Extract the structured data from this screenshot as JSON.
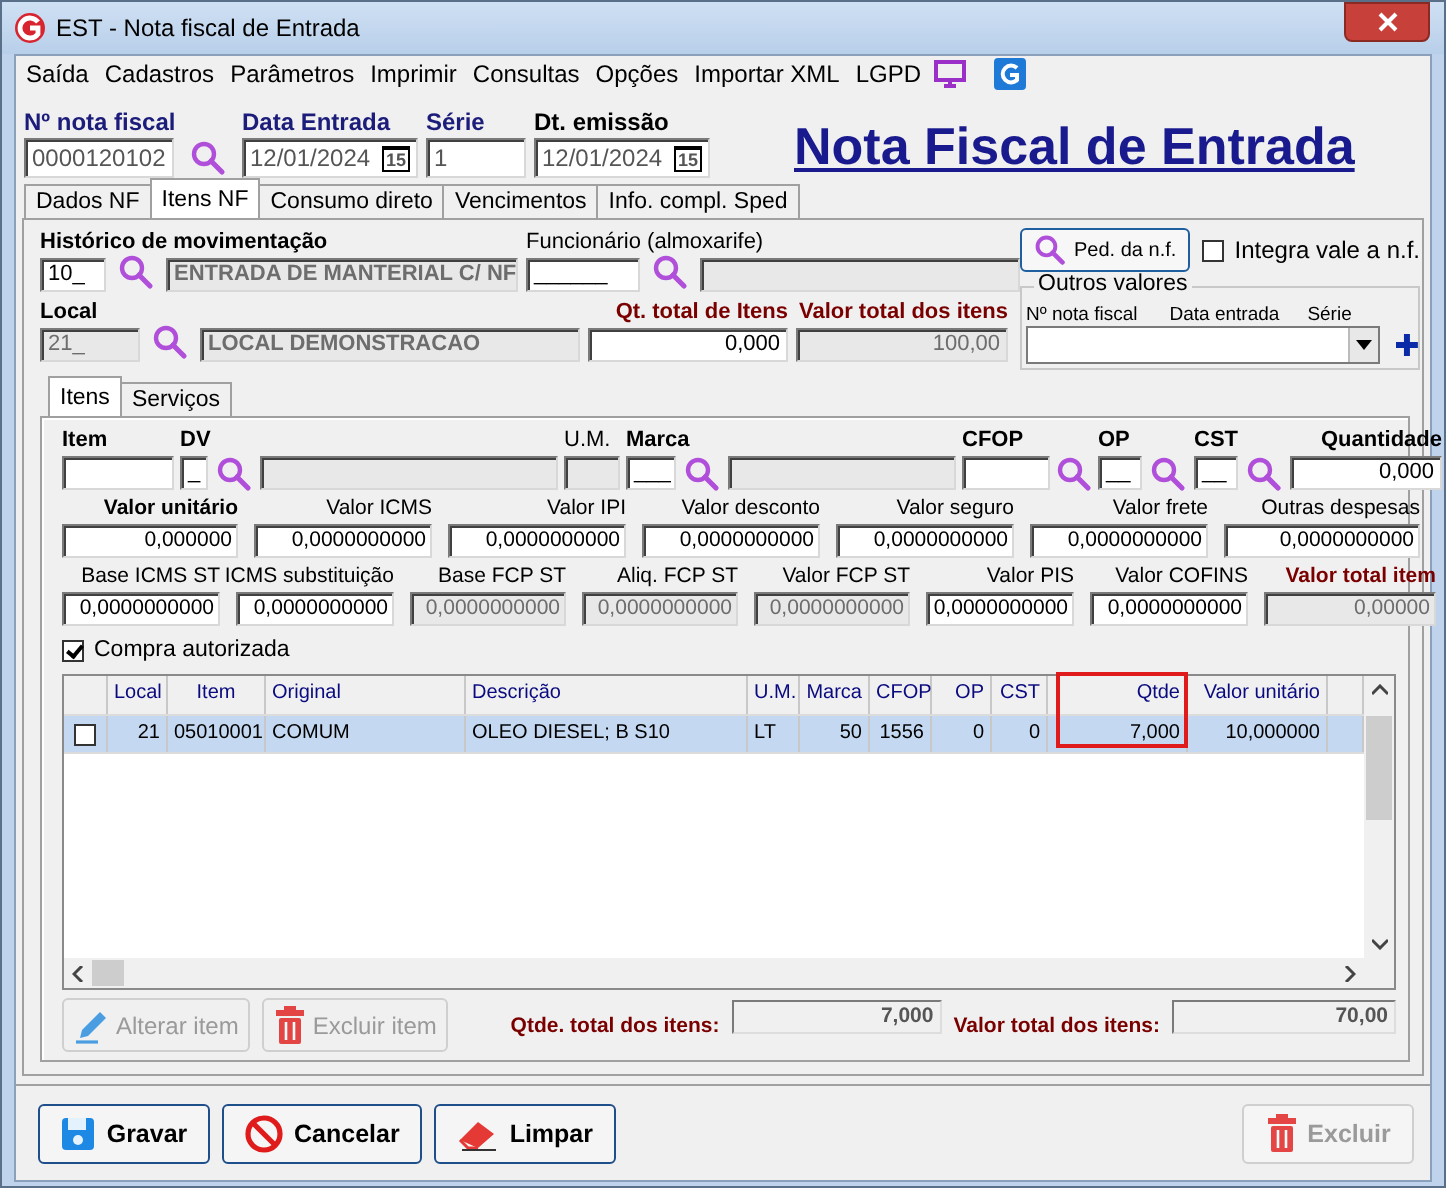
{
  "window": {
    "title": "EST - Nota fiscal de Entrada"
  },
  "menu": [
    {
      "label": "Saída"
    },
    {
      "label": "Cadastros"
    },
    {
      "label": "Parâmetros"
    },
    {
      "label": "Imprimir"
    },
    {
      "label": "Consultas"
    },
    {
      "label": "Opções"
    },
    {
      "label": "Importar XML"
    },
    {
      "label": "LGPD"
    }
  ],
  "header": {
    "title": "Nota Fiscal de Entrada",
    "fields": [
      {
        "kind": "text",
        "label": "Nº nota fiscal",
        "value": "0000120102",
        "enabled": true,
        "bold": true,
        "color": "#1c1c7a"
      },
      {
        "kind": "lookup"
      },
      {
        "kind": "date",
        "label": "Data Entrada",
        "value": "12/01/2024",
        "calendar": "15",
        "enabled": true,
        "bold": true,
        "color": "#1c1c7a"
      },
      {
        "kind": "text",
        "label": "Série",
        "value": "1",
        "enabled": true,
        "bold": true,
        "color": "#1c1c7a"
      },
      {
        "kind": "date",
        "label": "Dt. emissão",
        "value": "12/01/2024",
        "calendar": "15",
        "enabled": true,
        "bold": true
      }
    ]
  },
  "tabs": [
    {
      "label": "Dados NF",
      "selected": false
    },
    {
      "label": "Itens NF",
      "selected": true
    },
    {
      "label": "Consumo direto",
      "selected": false
    },
    {
      "label": "Vencimentos",
      "selected": false
    },
    {
      "label": "Info. compl. Sped",
      "selected": false
    }
  ],
  "movement_row": [
    {
      "kind": "text",
      "label": "Histórico de movimentação",
      "value": "10_",
      "enabled": true,
      "bold": true
    },
    {
      "kind": "lookup"
    },
    {
      "kind": "text",
      "value": "ENTRADA DE MANTERIAL C/ NF",
      "enabled": false,
      "bold": true
    },
    {
      "kind": "text",
      "label": "Funcionário (almoxarife)",
      "value": "______",
      "enabled": true,
      "bold": false
    },
    {
      "kind": "lookup"
    },
    {
      "kind": "text",
      "enabled": false
    }
  ],
  "order_button": {
    "label": "Ped. da n.f."
  },
  "integrate_checkbox": {
    "label": "Integra vale a n.f.",
    "checked": false
  },
  "local_row": [
    {
      "kind": "text",
      "label": "Local",
      "value": "21_",
      "enabled": false,
      "bold": true
    },
    {
      "kind": "lookup"
    },
    {
      "kind": "text",
      "value": "LOCAL DEMONSTRACAO",
      "enabled": false,
      "bold": true
    },
    {
      "kind": "number",
      "label": "Qt. total de Itens",
      "value": "0,000",
      "enabled": true,
      "bold": true,
      "color": "#7a0000"
    },
    {
      "kind": "number",
      "label": "Valor total dos itens",
      "value": "100,00",
      "enabled": false,
      "bold": true,
      "color": "#7a0000"
    }
  ],
  "other_values": {
    "title": "Outros valores",
    "columns": [
      "Nº nota fiscal",
      "Data entrada",
      "Série"
    ]
  },
  "inner_tabs": [
    {
      "label": "Itens",
      "selected": true
    },
    {
      "label": "Serviços",
      "selected": false
    }
  ],
  "item_row": [
    {
      "kind": "text",
      "label": "Item",
      "enabled": true,
      "bold": true
    },
    {
      "kind": "text",
      "label": "DV",
      "value": "_",
      "enabled": true,
      "bold": true
    },
    {
      "kind": "lookup"
    },
    {
      "kind": "text",
      "enabled": false
    },
    {
      "kind": "text",
      "label": "U.M.",
      "enabled": false,
      "bold": false
    },
    {
      "kind": "text",
      "label": "Marca",
      "value": "___",
      "enabled": true,
      "bold": true
    },
    {
      "kind": "lookup"
    },
    {
      "kind": "text",
      "enabled": false
    },
    {
      "kind": "text",
      "label": "CFOP",
      "enabled": true,
      "bold": true
    },
    {
      "kind": "lookup"
    },
    {
      "kind": "text",
      "label": "OP",
      "value": "__",
      "enabled": true,
      "bold": true
    },
    {
      "kind": "lookup"
    },
    {
      "kind": "text",
      "label": "CST",
      "value": "__",
      "enabled": true,
      "bold": true
    },
    {
      "kind": "lookup"
    },
    {
      "kind": "number",
      "label": "Quantidade",
      "value": "0,000",
      "enabled": true,
      "bold": true
    }
  ],
  "values_row": [
    {
      "kind": "number",
      "label": "Valor unitário",
      "value": "0,000000",
      "enabled": true,
      "bold": true
    },
    {
      "kind": "number",
      "label": "Valor ICMS",
      "value": "0,0000000000",
      "enabled": true,
      "bold": false
    },
    {
      "kind": "number",
      "label": "Valor IPI",
      "value": "0,0000000000",
      "enabled": true,
      "bold": false
    },
    {
      "kind": "number",
      "label": "Valor desconto",
      "value": "0,0000000000",
      "enabled": true,
      "bold": false
    },
    {
      "kind": "number",
      "label": "Valor seguro",
      "value": "0,0000000000",
      "enabled": true,
      "bold": false
    },
    {
      "kind": "number",
      "label": "Valor frete",
      "value": "0,0000000000",
      "enabled": true,
      "bold": false
    },
    {
      "kind": "number",
      "label": "Outras despesas",
      "value": "0,0000000000",
      "enabled": true,
      "bold": false
    }
  ],
  "taxes_row": [
    {
      "kind": "number",
      "label": "Base ICMS ST",
      "value": "0,0000000000",
      "enabled": true,
      "bold": false
    },
    {
      "kind": "number",
      "label": "ICMS substituição",
      "value": "0,0000000000",
      "enabled": true,
      "bold": false
    },
    {
      "kind": "number",
      "label": "Base FCP ST",
      "value": "0,0000000000",
      "enabled": false,
      "bold": false
    },
    {
      "kind": "number",
      "label": "Aliq. FCP ST",
      "value": "0,0000000000",
      "enabled": false,
      "bold": false
    },
    {
      "kind": "number",
      "label": "Valor FCP ST",
      "value": "0,0000000000",
      "enabled": false,
      "bold": false
    },
    {
      "kind": "number",
      "label": "Valor PIS",
      "value": "0,0000000000",
      "enabled": true,
      "bold": false
    },
    {
      "kind": "number",
      "label": "Valor COFINS",
      "value": "0,0000000000",
      "enabled": true,
      "bold": false
    },
    {
      "kind": "number",
      "label": "Valor total item",
      "value": "0,00000",
      "enabled": false,
      "bold": true,
      "color": "#7a0000"
    }
  ],
  "authorized_checkbox": {
    "label": "Compra autorizada",
    "checked": true
  },
  "table": {
    "columns": [
      {
        "label": "Local",
        "highlighted": false
      },
      {
        "label": "Item",
        "highlighted": false
      },
      {
        "label": "Original",
        "highlighted": false
      },
      {
        "label": "Descrição",
        "highlighted": false
      },
      {
        "label": "U.M.",
        "highlighted": false
      },
      {
        "label": "Marca",
        "highlighted": false
      },
      {
        "label": "CFOP",
        "highlighted": false
      },
      {
        "label": "OP",
        "highlighted": false
      },
      {
        "label": "CST",
        "highlighted": false
      },
      {
        "label": "Qtde",
        "highlighted": true
      },
      {
        "label": "Valor unitário",
        "highlighted": false
      }
    ],
    "rows": [
      {
        "checked": false,
        "selected": true,
        "cells": [
          "21",
          "05010001",
          "COMUM",
          "OLEO DIESEL; B S10",
          "LT",
          "50",
          "1556",
          "0",
          "0",
          "7,000",
          "10,000000"
        ]
      }
    ]
  },
  "item_buttons": [
    {
      "label": "Alterar item",
      "kind": "edit",
      "enabled": false
    },
    {
      "label": "Excluir item",
      "kind": "delete",
      "enabled": false
    }
  ],
  "totals": [
    {
      "label": "Qtde. total dos itens:",
      "value": "7,000"
    },
    {
      "label": "Valor total dos itens:",
      "value": "70,00"
    }
  ],
  "footer_buttons": [
    {
      "label": "Gravar",
      "kind": "save",
      "enabled": true
    },
    {
      "label": "Cancelar",
      "kind": "cancel",
      "enabled": true
    },
    {
      "label": "Limpar",
      "kind": "clear",
      "enabled": true
    },
    {
      "label": "Excluir",
      "kind": "delete",
      "enabled": false
    }
  ]
}
